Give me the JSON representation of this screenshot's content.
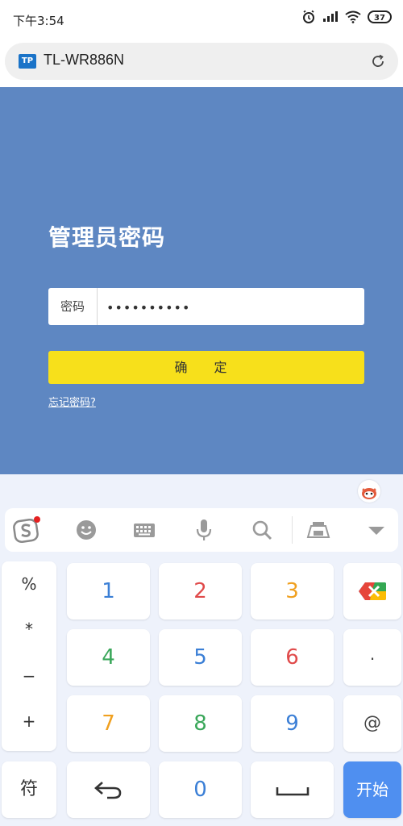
{
  "status": {
    "time": "下午3:54",
    "battery": "37"
  },
  "browser": {
    "url": "TL-WR886N",
    "site_logo": "TP"
  },
  "login": {
    "title": "管理员密码",
    "password_label": "密码",
    "password_value": "••••••••••",
    "confirm_label": "确 定",
    "forgot_link": "忘记密码?"
  },
  "keyboard": {
    "symbols": [
      "%",
      "*",
      "−",
      "+"
    ],
    "digit_rows": [
      [
        "1",
        "2",
        "3"
      ],
      [
        "4",
        "5",
        "6"
      ],
      [
        "7",
        "8",
        "9"
      ]
    ],
    "digit_colors": [
      [
        "#3b7fd6",
        "#e04a4a",
        "#f0a01f"
      ],
      [
        "#3aa75a",
        "#3b7fd6",
        "#e04a4a"
      ],
      [
        "#f0a01f",
        "#3aa75a",
        "#3b7fd6"
      ]
    ],
    "dot": ".",
    "at": "@",
    "symbol_key": "符",
    "zero": "0",
    "start_key": "开始",
    "colors": {
      "start_bg": "#4f8ff0",
      "login_bg": "#5e87c2",
      "confirm_bg": "#f7e01b"
    }
  }
}
